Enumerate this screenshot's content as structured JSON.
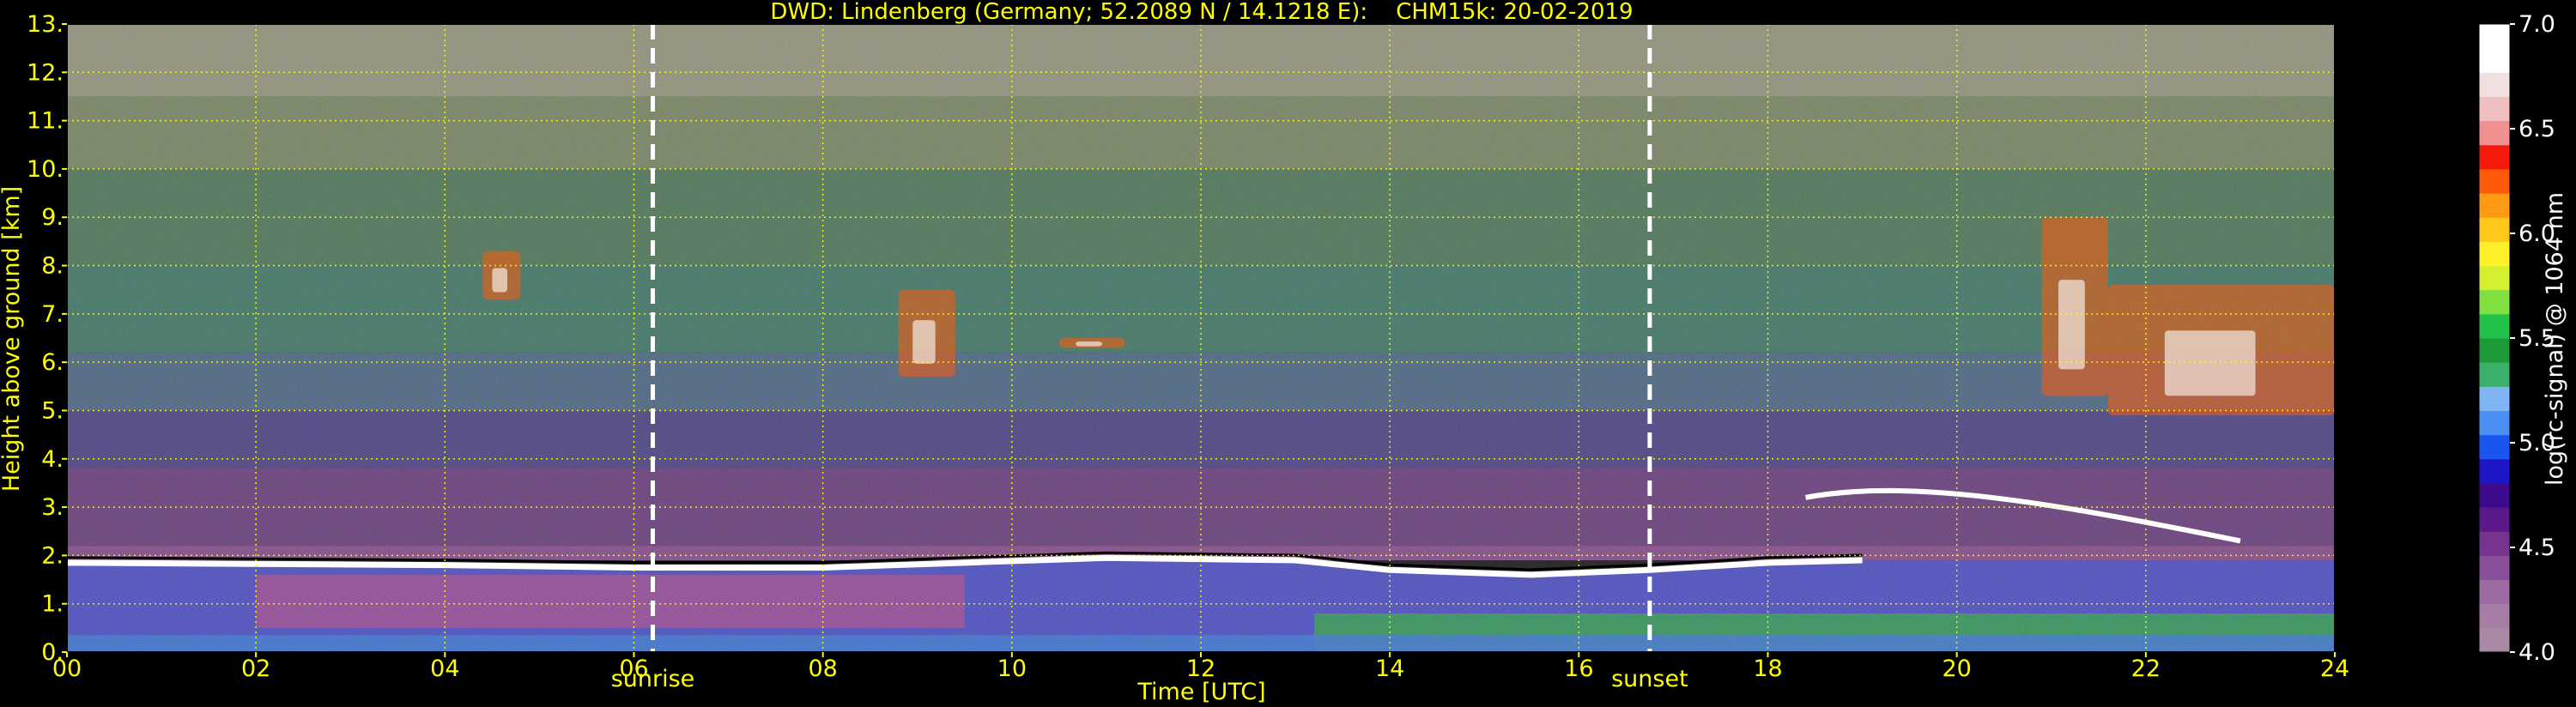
{
  "chart_data": {
    "type": "heatmap",
    "title": "DWD: Lindenberg (Germany; 52.2089 N / 14.1218 E):    CHM15k: 20-02-2019",
    "xlabel": "Time [UTC]",
    "ylabel": "Height above ground [km]",
    "xlim": [
      0,
      24
    ],
    "ylim": [
      0,
      13
    ],
    "x_ticks": [
      "00",
      "02",
      "04",
      "06",
      "08",
      "10",
      "12",
      "14",
      "16",
      "18",
      "20",
      "22",
      "24"
    ],
    "y_ticks": [
      "0.",
      "1.",
      "2.",
      "3.",
      "4.",
      "5.",
      "6.",
      "7.",
      "8.",
      "9.",
      "10.",
      "11.",
      "12.",
      "13."
    ],
    "grid": true,
    "markers": [
      {
        "label": "sunrise",
        "time": 6.2
      },
      {
        "label": "sunset",
        "time": 16.75
      }
    ],
    "features": {
      "boundary_layer_top_km": [
        [
          0,
          1.85
        ],
        [
          4,
          1.8
        ],
        [
          6,
          1.75
        ],
        [
          8,
          1.75
        ],
        [
          9.5,
          1.85
        ],
        [
          11,
          1.95
        ],
        [
          13,
          1.9
        ],
        [
          14,
          1.7
        ],
        [
          15.5,
          1.6
        ],
        [
          16.75,
          1.7
        ],
        [
          18,
          1.85
        ],
        [
          19,
          1.9
        ]
      ],
      "elevated_layer": {
        "start": 18.4,
        "end": 23.0,
        "height_km": 3.2
      },
      "high_cloud_events": [
        {
          "start": 4.4,
          "end": 4.8,
          "bottom_km": 7.3,
          "top_km": 8.3
        },
        {
          "start": 8.8,
          "end": 9.4,
          "bottom_km": 5.7,
          "top_km": 7.5
        },
        {
          "start": 10.5,
          "end": 11.2,
          "bottom_km": 6.3,
          "top_km": 6.5
        },
        {
          "start": 20.9,
          "end": 21.6,
          "bottom_km": 5.3,
          "top_km": 9.0
        },
        {
          "start": 21.6,
          "end": 24.0,
          "bottom_km": 4.9,
          "top_km": 7.6
        }
      ]
    },
    "colorbar": {
      "label": "log(rc-signal) @ 1064 nm",
      "range": [
        4.0,
        7.0
      ],
      "ticks": [
        "4.0",
        "4.5",
        "5.0",
        "5.5",
        "6.0",
        "6.5",
        "7.0"
      ]
    }
  },
  "colors": {
    "text": "#ffff00",
    "grid": "#ffff00",
    "background": "#000000",
    "colorbar_stops": [
      "#a88aa5",
      "#a77da6",
      "#9d6aa2",
      "#8a4f9a",
      "#76338f",
      "#5a188a",
      "#3d0a8c",
      "#1e17c8",
      "#1b55f0",
      "#4b8ff5",
      "#7fb5f5",
      "#3bb06a",
      "#1d9a3a",
      "#22c24a",
      "#7fe040",
      "#d6f030",
      "#fff02a",
      "#ffc81a",
      "#ff9a12",
      "#ff5a0a",
      "#f51a0a",
      "#f09090",
      "#f0c0c0",
      "#f0e0e0",
      "#ffffff",
      "#ffffff"
    ]
  }
}
